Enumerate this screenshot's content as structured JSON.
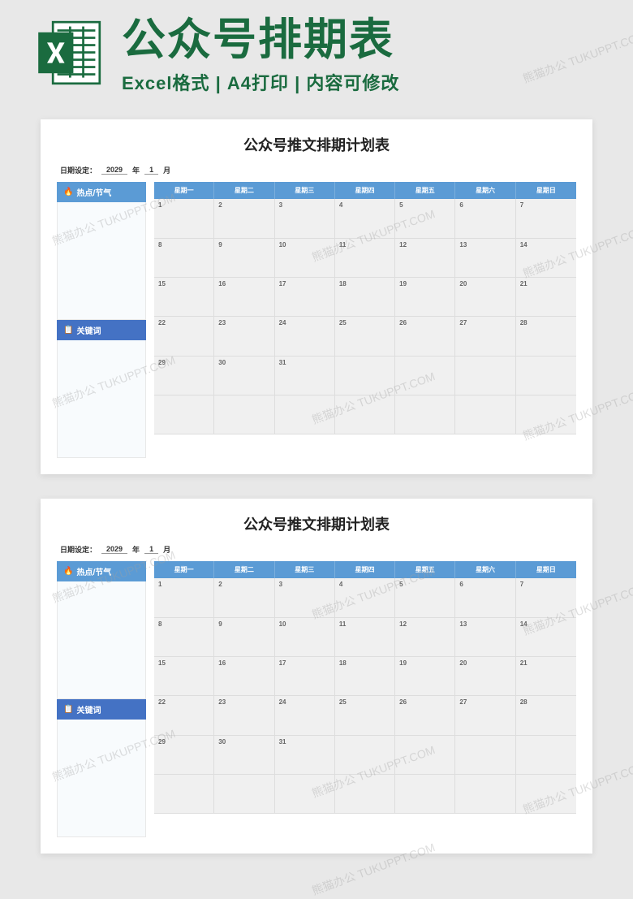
{
  "header": {
    "main_title": "公众号排期表",
    "sub_title": "Excel格式 | A4打印 | 内容可修改"
  },
  "document": {
    "title": "公众号推文排期计划表",
    "date_label": "日期设定：",
    "year": "2029",
    "year_suffix": "年",
    "month": "1",
    "month_suffix": "月",
    "sidebar_hotspot": "热点/节气",
    "sidebar_keywords": "关键词",
    "weekdays": [
      "星期一",
      "星期二",
      "星期三",
      "星期四",
      "星期五",
      "星期六",
      "星期日"
    ],
    "days": [
      "1",
      "2",
      "3",
      "4",
      "5",
      "6",
      "7",
      "8",
      "9",
      "10",
      "11",
      "12",
      "13",
      "14",
      "15",
      "16",
      "17",
      "18",
      "19",
      "20",
      "21",
      "22",
      "23",
      "24",
      "25",
      "26",
      "27",
      "28",
      "29",
      "30",
      "31",
      "",
      "",
      "",
      "",
      "",
      "",
      "",
      "",
      "",
      "",
      ""
    ]
  },
  "watermark": "熊猫办公 TUKUPPT.COM"
}
